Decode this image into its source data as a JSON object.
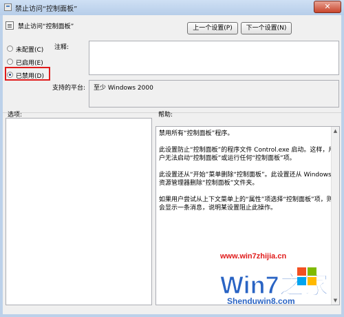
{
  "window": {
    "title": "禁止访问“控制面板”"
  },
  "header": {
    "title": "禁止访问“控制面板”",
    "prev_label": "上一个设置(P)",
    "next_label": "下一个设置(N)"
  },
  "state": {
    "options": [
      {
        "label": "未配置(C)",
        "checked": false
      },
      {
        "label": "已启用(E)",
        "checked": false
      },
      {
        "label": "已禁用(D)",
        "checked": true
      }
    ]
  },
  "comment": {
    "label": "注释:",
    "value": ""
  },
  "platform": {
    "label": "支持的平台:",
    "value": "至少 Windows 2000"
  },
  "options_pane": {
    "label": "选项:"
  },
  "help_pane": {
    "label": "帮助:",
    "paragraphs": [
      "禁用所有“控制面板”程序。",
      "此设置防止“控制面板”的程序文件 Control.exe 启动。这样，用户无法启动“控制面板”或运行任何“控制面板”项。",
      "此设置还从“开始”菜单删除“控制面板”。此设置还从 Windows 资源管理器删除“控制面板”文件夹。",
      "如果用户尝试从上下文菜单上的“属性”项选择“控制面板”项，则会显示一条消息，说明某设置阻止此操作。"
    ]
  },
  "watermark": {
    "url": "www.win7zhijia.cn",
    "logo_text": "Win7之家",
    "site": "Shenduwin8.com"
  },
  "colors": {
    "highlight": "#e01b1b",
    "accent": "#2a64c4",
    "check": "#1a3d7c"
  }
}
